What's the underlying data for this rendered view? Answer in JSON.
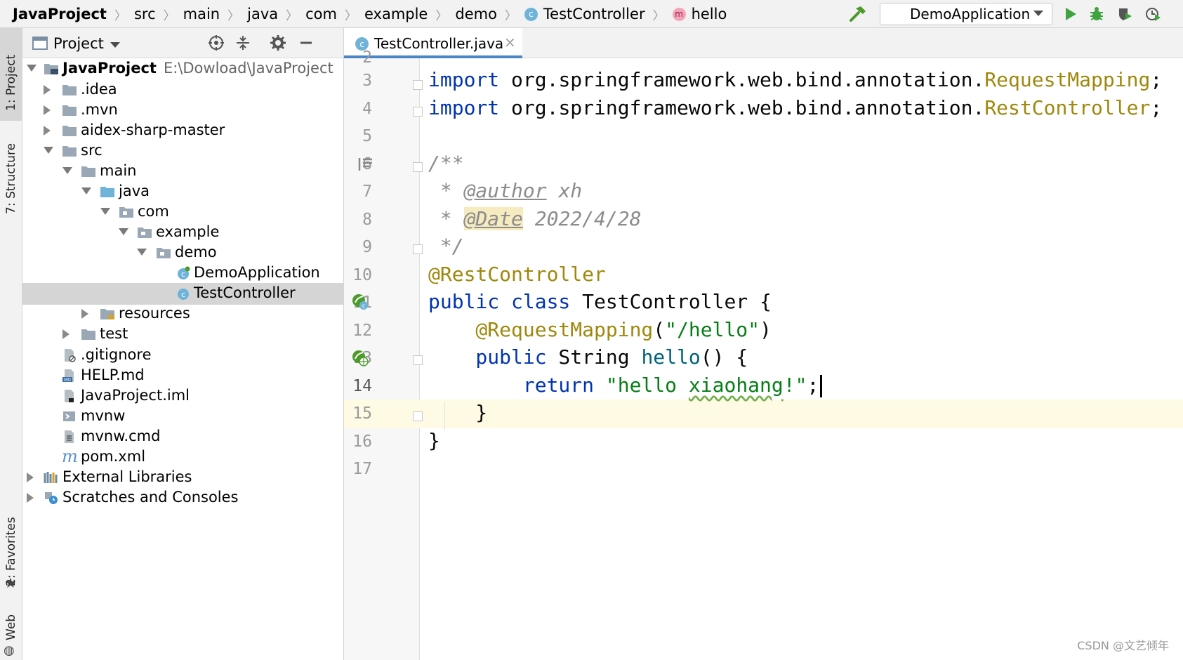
{
  "navbar": {
    "crumbs": [
      "JavaProject",
      "src",
      "main",
      "java",
      "com",
      "example",
      "demo",
      "TestController",
      "hello"
    ],
    "run_config": "DemoApplication"
  },
  "tool_strip": {
    "project": "1: Project",
    "structure": "7: Structure",
    "favorites": "2: Favorites",
    "web": "Web"
  },
  "project_panel": {
    "title": "Project",
    "tree": [
      {
        "label": "JavaProject",
        "path": "E:\\Dowload\\JavaProject",
        "bold": true
      },
      {
        "label": ".idea"
      },
      {
        "label": ".mvn"
      },
      {
        "label": "aidex-sharp-master"
      },
      {
        "label": "src"
      },
      {
        "label": "main"
      },
      {
        "label": "java"
      },
      {
        "label": "com"
      },
      {
        "label": "example"
      },
      {
        "label": "demo"
      },
      {
        "label": "DemoApplication"
      },
      {
        "label": "TestController",
        "selected": true
      },
      {
        "label": "resources"
      },
      {
        "label": "test"
      },
      {
        "label": ".gitignore"
      },
      {
        "label": "HELP.md"
      },
      {
        "label": "JavaProject.iml"
      },
      {
        "label": "mvnw"
      },
      {
        "label": "mvnw.cmd"
      },
      {
        "label": "pom.xml"
      },
      {
        "label": "External Libraries"
      },
      {
        "label": "Scratches and Consoles"
      }
    ]
  },
  "editor": {
    "tab": "TestController.java",
    "line_numbers": [
      "2",
      "3",
      "4",
      "5",
      "6",
      "7",
      "8",
      "9",
      "10",
      "11",
      "12",
      "13",
      "14",
      "15",
      "16",
      "17"
    ],
    "current_line": "14",
    "code": {
      "l3_kw": "import",
      "l3_pkg": " org.springframework.web.bind.annotation.",
      "l3_cls": "RequestMapping",
      "l3_end": ";",
      "l4_kw": "import",
      "l4_pkg": " org.springframework.web.bind.annotation.",
      "l4_cls": "RestController",
      "l4_end": ";",
      "l6": "/**",
      "l7_star": " * ",
      "l7_tag": "@author",
      "l7_val": " xh",
      "l8_star": " * ",
      "l8_tag": "@Date",
      "l8_val": " 2022/4/28",
      "l9": " */",
      "l10": "@RestController",
      "l11_kw": "public class",
      "l11_rest": " TestController {",
      "l12_ann": "    @RequestMapping",
      "l12_open": "(",
      "l12_str": "\"/hello\"",
      "l12_close": ")",
      "l13_kw": "    public",
      "l13_type": " String ",
      "l13_meth": "hello",
      "l13_rest": "() {",
      "l14_kw": "        return",
      "l14_sp": " ",
      "l14_str1": "\"hello ",
      "l14_str2": "xiaohang",
      "l14_str3": "!\"",
      "l14_end": ";",
      "l15": "    }",
      "l16": "}"
    }
  },
  "watermark": "CSDN @文艺倾年",
  "colors": {
    "keyword": "#0033b3",
    "annotation": "#9e880d",
    "string": "#067d17",
    "comment": "#8c8c8c",
    "selection": "#d5d5d5",
    "current_line": "#fffae3",
    "tab_underline": "#4a86c8"
  }
}
